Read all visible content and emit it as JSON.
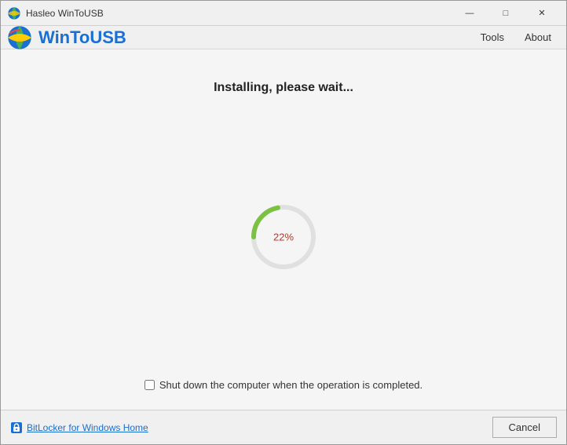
{
  "window": {
    "title": "Hasleo WinToUSB",
    "controls": {
      "minimize": "—",
      "maximize": "□",
      "close": "✕"
    }
  },
  "app": {
    "title": "WinToUSB"
  },
  "menu": {
    "tools_label": "Tools",
    "about_label": "About"
  },
  "main": {
    "status_text": "Installing, please wait...",
    "progress_percent": 22,
    "progress_label": "22%"
  },
  "checkbox": {
    "label": "Shut down the computer when the operation is completed."
  },
  "footer": {
    "bitlocker_label": "BitLocker for Windows Home",
    "cancel_label": "Cancel"
  },
  "colors": {
    "progress_track": "#e0e0e0",
    "progress_fill": "#7dc142",
    "progress_text": "#c0392b"
  }
}
